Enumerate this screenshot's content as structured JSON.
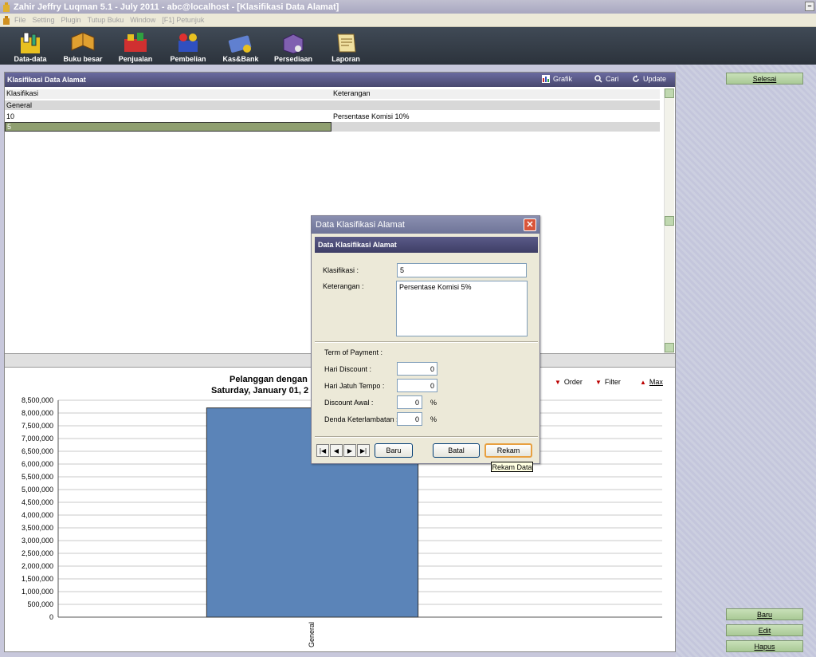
{
  "window": {
    "title": "Zahir Jeffry Luqman 5.1 - July 2011 - abc@localhost - [Klasifikasi Data Alamat]",
    "restore_glyph": "–"
  },
  "menu": [
    "File",
    "Setting",
    "Plugin",
    "Tutup Buku",
    "Window",
    "[F1] Petunjuk"
  ],
  "toolbar": [
    {
      "label": "Data-data",
      "icon": "data-icon"
    },
    {
      "label": "Buku besar",
      "icon": "ledger-book-icon"
    },
    {
      "label": "Penjualan",
      "icon": "sales-icon"
    },
    {
      "label": "Pembelian",
      "icon": "purchase-icon"
    },
    {
      "label": "Kas&Bank",
      "icon": "cash-bank-icon"
    },
    {
      "label": "Persediaan",
      "icon": "inventory-icon"
    },
    {
      "label": "Laporan",
      "icon": "report-icon"
    }
  ],
  "side": {
    "selesai": "Selesai",
    "baru": "Baru",
    "edit": "Edit",
    "hapus": "Hapus"
  },
  "panel": {
    "title": "Klasifikasi Data Alamat",
    "grafik": "Grafik",
    "cari": "Cari",
    "update": "Update",
    "columns": [
      "Klasifikasi",
      "Keterangan"
    ],
    "rows": [
      {
        "a": "General",
        "b": ""
      },
      {
        "a": "10",
        "b": "Persentase Komisi 10%"
      },
      {
        "a": "5",
        "b": ""
      }
    ]
  },
  "chart_controls": {
    "order": "Order",
    "filter": "Filter",
    "max": "Max"
  },
  "chart_data": {
    "type": "bar",
    "title": "Pelanggan dengan",
    "subtitle": "Saturday, January 01, 2",
    "categories": [
      "General"
    ],
    "values": [
      8200000
    ],
    "ylim": [
      0,
      8500000
    ],
    "yticks": [
      "8,500,000",
      "8,000,000",
      "7,500,000",
      "7,000,000",
      "6,500,000",
      "6,000,000",
      "5,500,000",
      "5,000,000",
      "4,500,000",
      "4,000,000",
      "3,500,000",
      "3,000,000",
      "2,500,000",
      "2,000,000",
      "1,500,000",
      "1,000,000",
      "500,000",
      "0"
    ],
    "bar_color": "#5b84b8",
    "grid": true
  },
  "dialog": {
    "title": "Data Klasifikasi Alamat",
    "header": "Data Klasifikasi Alamat",
    "close": "✕",
    "klasifikasi_label": "Klasifikasi :",
    "klasifikasi_value": "5",
    "keterangan_label": "Keterangan :",
    "keterangan_value": "Persentase Komisi 5%",
    "term_label": "Term of Payment :",
    "hari_discount_label": "Hari Discount :",
    "hari_discount_value": "0",
    "hari_jatuh_label": "Hari Jatuh Tempo :",
    "hari_jatuh_value": "0",
    "discount_awal_label": "Discount Awal :",
    "discount_awal_value": "0",
    "denda_label": "Denda Keterlambatan :",
    "denda_value": "0",
    "percent": "%",
    "nav": [
      "|◀",
      "◀",
      "▶",
      "▶|"
    ],
    "baru": "Baru",
    "batal": "Batal",
    "rekam": "Rekam",
    "tooltip": "Rekam Data"
  }
}
